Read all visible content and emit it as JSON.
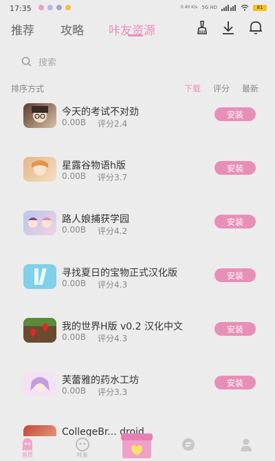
{
  "status_bar": {
    "time": "17:35",
    "speed": "0.40 K/s",
    "net": "5G HD",
    "battery": "81"
  },
  "tabs": [
    {
      "label": "推荐",
      "active": false
    },
    {
      "label": "攻略",
      "active": false
    },
    {
      "label": "咔友资源",
      "active": true
    }
  ],
  "header_icons": [
    "mop-icon",
    "download-icon",
    "bell-icon"
  ],
  "search": {
    "placeholder": "搜索"
  },
  "sort": {
    "label": "排序方式",
    "options": [
      {
        "label": "下载",
        "active": true
      },
      {
        "label": "评分",
        "active": false
      },
      {
        "label": "最新",
        "active": false
      }
    ]
  },
  "apps": [
    {
      "name": "今天的考试不对劲",
      "size": "0.00B",
      "rating": "评分2.4",
      "install": "安装"
    },
    {
      "name": "星露谷物语h版",
      "size": "0.00B",
      "rating": "评分3.7",
      "install": "安装"
    },
    {
      "name": "路人娘捕获学园",
      "size": "0.00B",
      "rating": "评分4.2",
      "install": "安装"
    },
    {
      "name": "寻找夏日的宝物正式汉化版",
      "size": "0.00B",
      "rating": "评分4.3",
      "install": "安装"
    },
    {
      "name": "我的世界H版 v0.2 汉化中文",
      "size": "0.00B",
      "rating": "评分4.3",
      "install": "安装"
    },
    {
      "name": "芙蕾雅的药水工坊",
      "size": "0.00B",
      "rating": "评分3.3",
      "install": "安装"
    },
    {
      "name": "CollegeBr... droid",
      "size": "",
      "rating": "",
      "install": ""
    }
  ],
  "bottom_nav": [
    {
      "label": "首页",
      "icon": "ghost-icon",
      "active": true
    },
    {
      "label": "咔友",
      "icon": "gamepad-icon",
      "active": false
    },
    {
      "label": "",
      "icon": "gift-box-icon",
      "active": false
    },
    {
      "label": "",
      "icon": "chat-icon",
      "active": false
    },
    {
      "label": "",
      "icon": "profile-icon",
      "active": false
    }
  ],
  "colors": {
    "accent": "#e88fb7",
    "background": "#ececec"
  }
}
